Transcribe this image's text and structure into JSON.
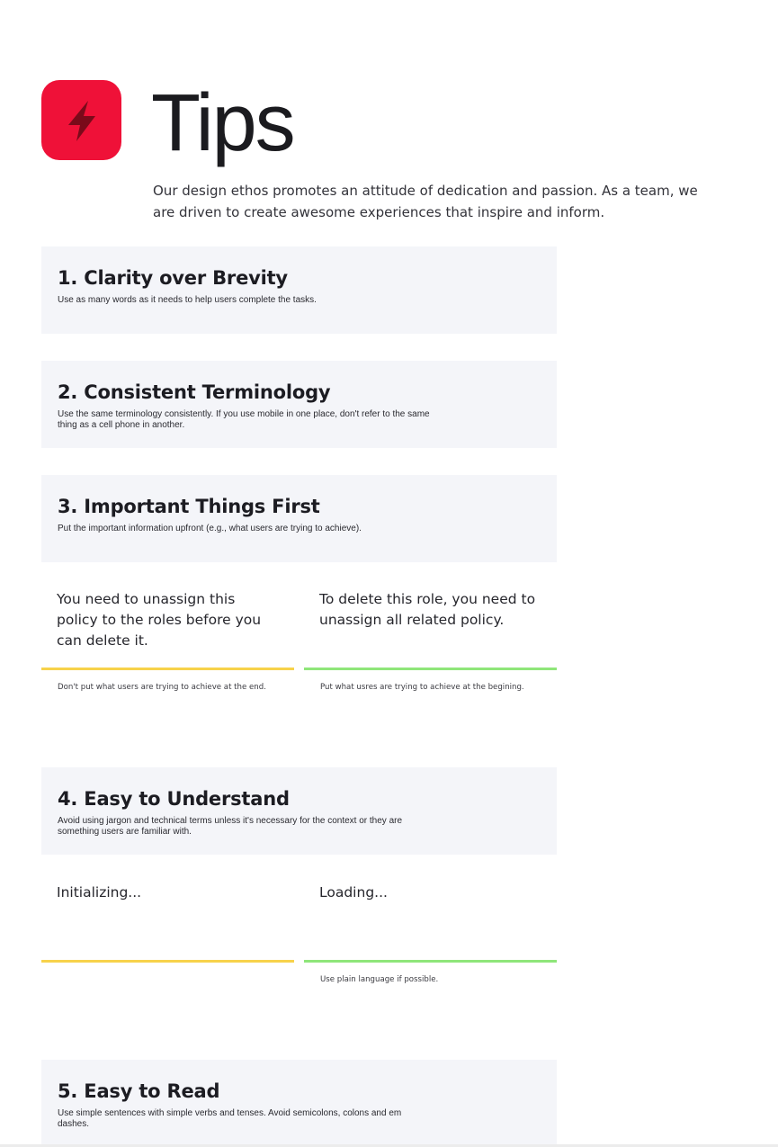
{
  "header": {
    "logo_icon": "lightning-bolt-icon",
    "title": "Tips",
    "intro": "Our design ethos promotes an attitude of dedication and passion. As a team, we are driven to create awesome experiences that inspire and inform."
  },
  "colors": {
    "brand": "#ef1138",
    "card_bg": "#f4f5f9",
    "dont": "#f7d24b",
    "do": "#8fe67a"
  },
  "tips": [
    {
      "title": "1. Clarity over Brevity",
      "desc": "Use as many words as it needs to help users complete the tasks."
    },
    {
      "title": "2. Consistent Terminology",
      "desc": "Use the same terminology consistently. If you use mobile in one place, don't refer to the same thing as a cell phone in another."
    },
    {
      "title": "3. Important Things First",
      "desc": "Put the important information upfront (e.g., what users are trying to achieve)."
    },
    {
      "title": "4. Easy to Understand",
      "desc": "Avoid using jargon and technical terms unless it's necessary for the context or they are something users are familiar with."
    },
    {
      "title": "5. Easy to Read",
      "desc": "Use simple sentences with simple verbs and tenses. Avoid semicolons, colons and em dashes."
    }
  ],
  "examples_3": {
    "dont": {
      "text": "You need to unassign this policy to the roles before you can delete it.",
      "note": "Don't put what users are trying to achieve at the end."
    },
    "do": {
      "text": "To delete this role, you need to unassign all related policy.",
      "note": "Put what usres are trying to achieve at the begining."
    }
  },
  "examples_4": {
    "dont": {
      "text": "Initializing...",
      "note": ""
    },
    "do": {
      "text": "Loading...",
      "note": "Use plain language if possible."
    }
  }
}
